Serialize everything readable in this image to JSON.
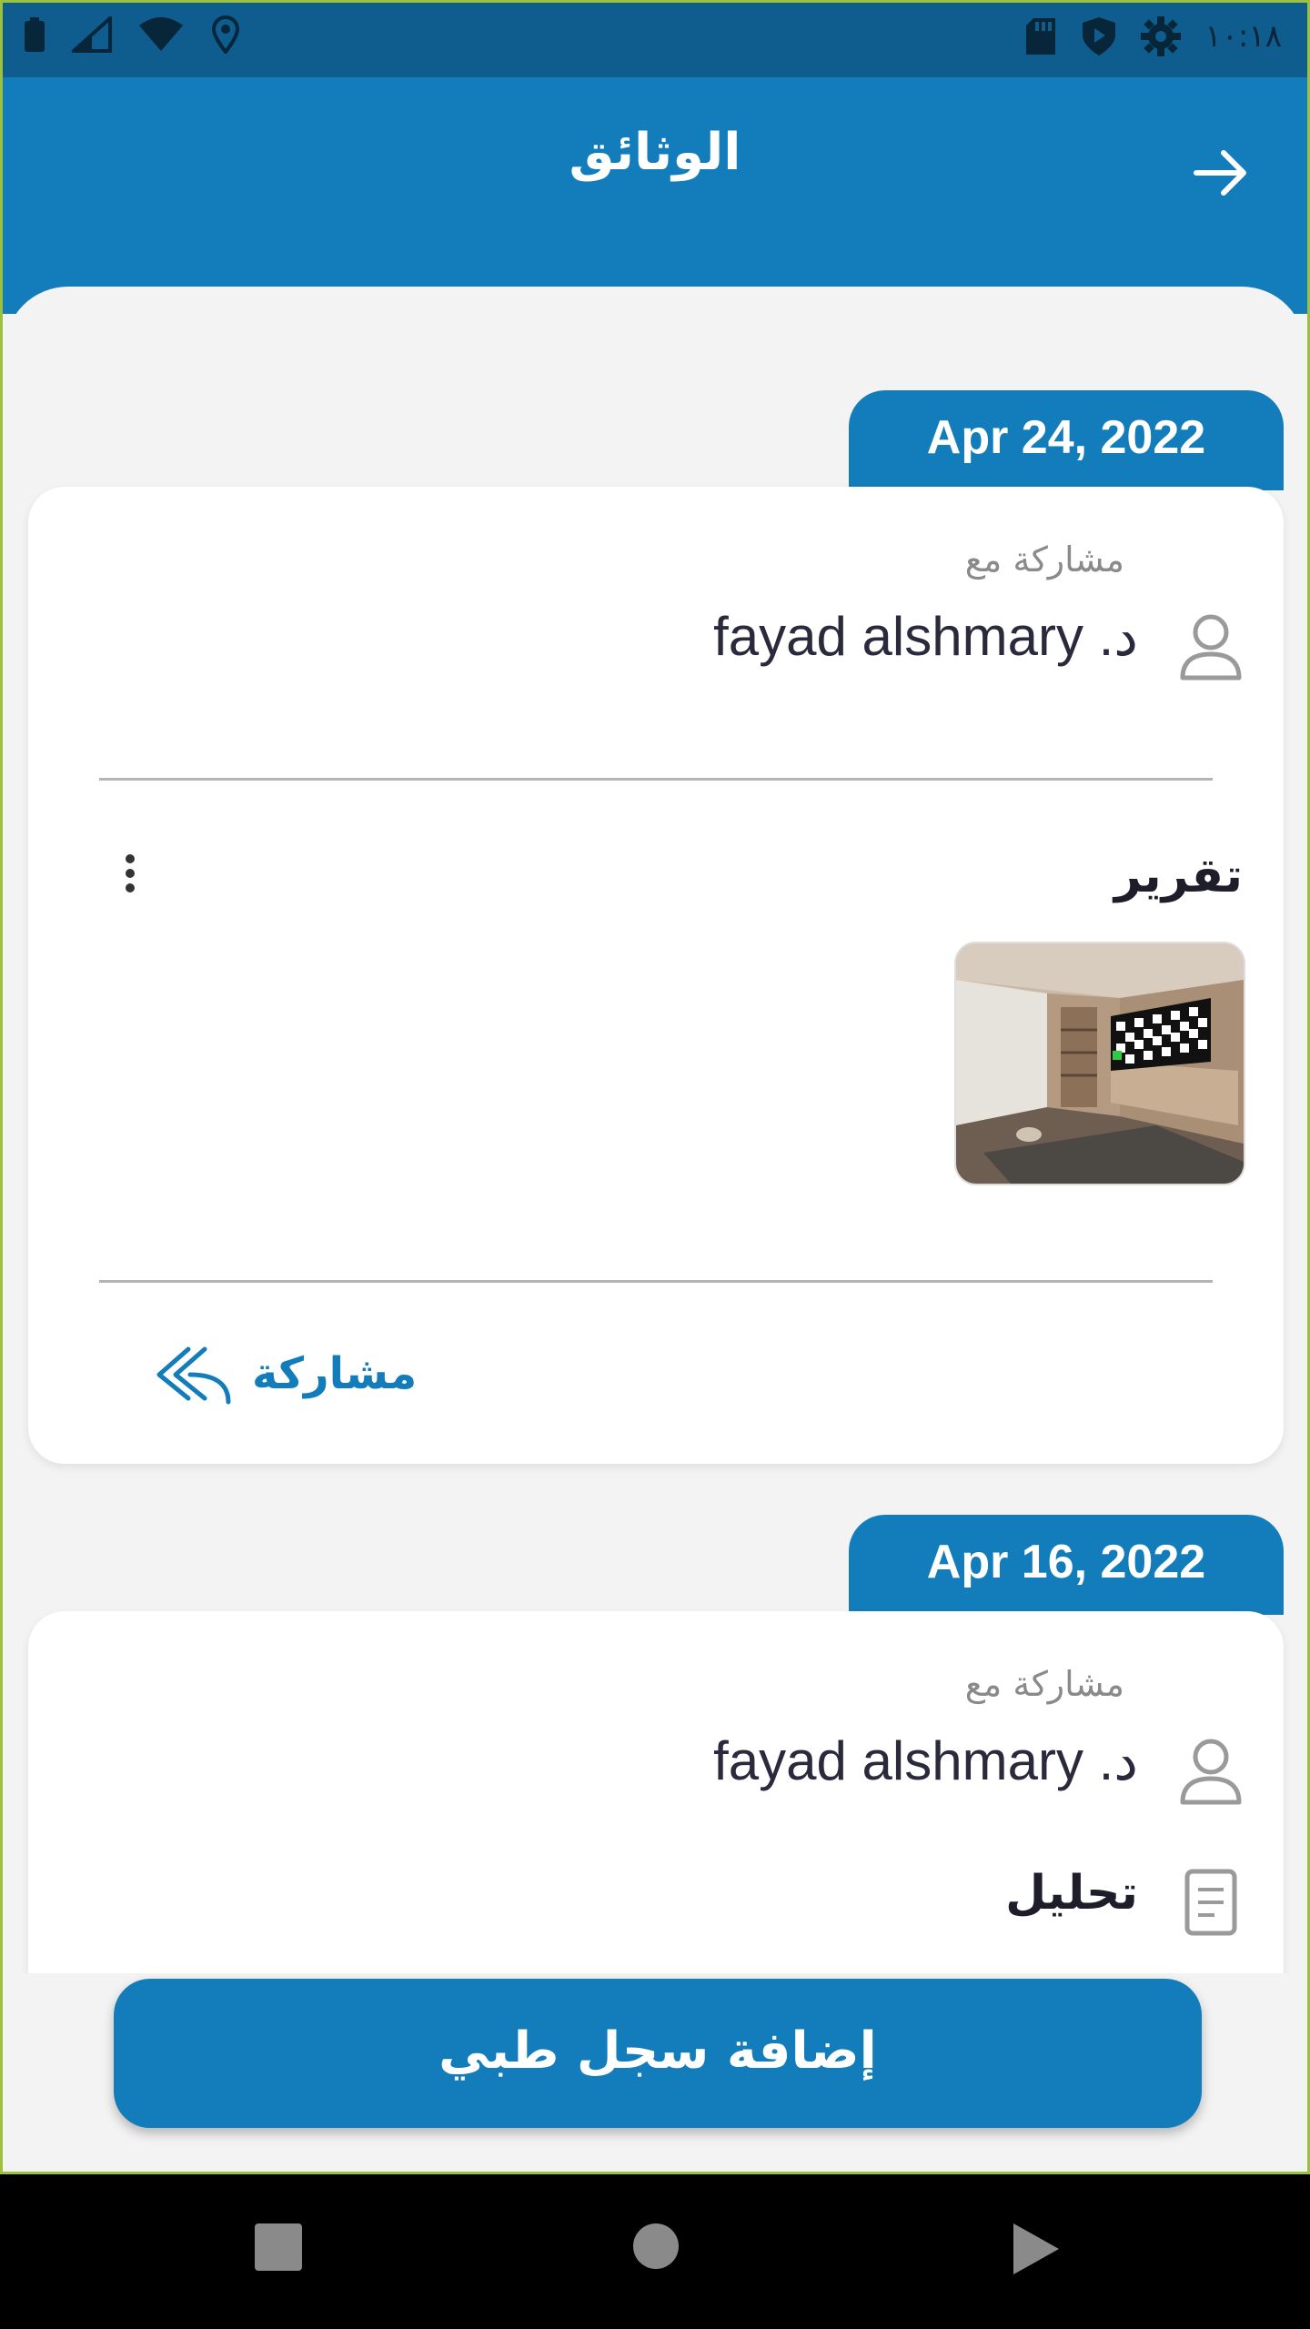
{
  "status_bar": {
    "time": "١٠:١٨",
    "left_icons": [
      "battery-icon",
      "signal-icon",
      "wifi-icon",
      "location-icon"
    ],
    "right_icons": [
      "sd-card-icon",
      "shield-icon",
      "settings-icon"
    ]
  },
  "header": {
    "title": "الوثائق",
    "back_icon": "arrow-right-icon"
  },
  "records": [
    {
      "date": "Apr 24, 2022",
      "shared_with_label": "مشاركة مع",
      "doctor": "fayad alshmary .د",
      "document_title": "تقرير",
      "has_image": true,
      "share_label": "مشاركة"
    },
    {
      "date": "Apr 16, 2022",
      "shared_with_label": "مشاركة مع",
      "doctor": "fayad alshmary .د",
      "document_title": "تحليل"
    }
  ],
  "add_button_label": "إضافة سجل طبي",
  "colors": {
    "primary": "#127dba",
    "status_bar": "#0f5c8e",
    "background": "#f3f3f3"
  }
}
